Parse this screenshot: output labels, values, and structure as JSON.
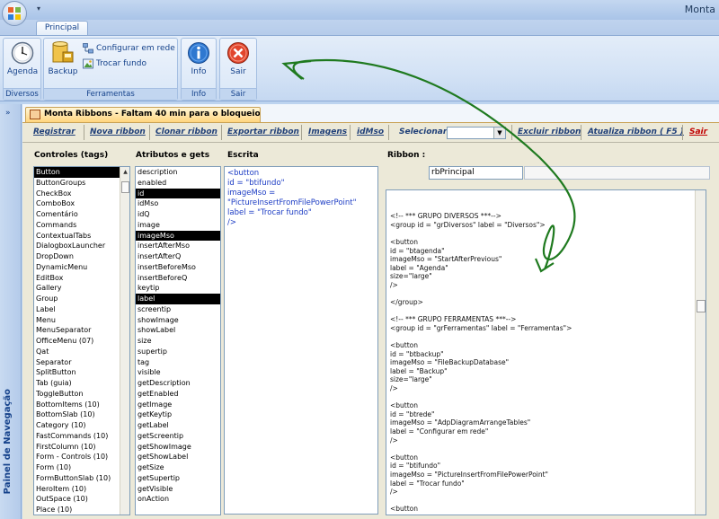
{
  "window": {
    "title": "Monta"
  },
  "tabs": [
    {
      "label": "Principal"
    }
  ],
  "ribbon": {
    "groups": [
      {
        "label": "Diversos",
        "buttons": [
          {
            "label": "Agenda",
            "icon": "clock-icon"
          }
        ]
      },
      {
        "label": "Ferramentas",
        "buttons": [
          {
            "label": "Backup",
            "icon": "database-backup-icon"
          },
          {
            "label": "Configurar em rede",
            "icon": "network-icon"
          },
          {
            "label": "Trocar fundo",
            "icon": "picture-icon"
          }
        ]
      },
      {
        "label": "Info",
        "buttons": [
          {
            "label": "Info",
            "icon": "info-icon"
          }
        ]
      },
      {
        "label": "Sair",
        "buttons": [
          {
            "label": "Sair",
            "icon": "close-icon"
          }
        ]
      }
    ]
  },
  "nav_pane": {
    "label": "Painel de Navegação",
    "toggle": "»"
  },
  "form": {
    "tab_title": "Monta Ribbons - Faltam 40 min para o bloqueio...",
    "toolbar": {
      "registrar": "Registrar",
      "nova_ribbon": "Nova ribbon",
      "clonar_ribbon": "Clonar ribbon",
      "exportar_ribbon": "Exportar ribbon",
      "imagens": "Imagens",
      "idmso": "idMso",
      "selecionar": "Selecionar",
      "selecionar_value": "",
      "excluir_ribbon": "Excluir ribbon",
      "atualiza_ribbon": "Atualiza ribbon ( F5 )",
      "sair": "Sair"
    },
    "labels": {
      "controles": "Controles (tags)",
      "atributos": "Atributos e gets",
      "escrita": "Escrita",
      "ribbon": "Ribbon :"
    },
    "ribbon_name": "rbPrincipal",
    "controles": [
      "Button",
      "ButtonGroups",
      "CheckBox",
      "ComboBox",
      "Comentário",
      "Commands",
      "ContextualTabs",
      "DialogboxLauncher",
      "DropDown",
      "DynamicMenu",
      "EditBox",
      "Gallery",
      "Group",
      "Label",
      "Menu",
      "MenuSeparator",
      "OfficeMenu (07)",
      "Qat",
      "Separator",
      "SplitButton",
      "Tab (guia)",
      "ToggleButton",
      "BottomItems (10)",
      "BottomSlab (10)",
      "Category (10)",
      "FastCommands (10)",
      "FirstColumn (10)",
      "Form - Controls (10)",
      "Form (10)",
      "FormButtonSlab (10)",
      "HeroItem (10)",
      "OutSpace (10)",
      "Place (10)"
    ],
    "controles_selected": 0,
    "atributos": [
      "description",
      "enabled",
      "id",
      "idMso",
      "idQ",
      "image",
      "imageMso",
      "insertAfterMso",
      "insertAfterQ",
      "insertBeforeMso",
      "insertBeforeQ",
      "keytip",
      "label",
      "screentip",
      "showImage",
      "showLabel",
      "size",
      "supertip",
      "tag",
      "visible",
      "getDescription",
      "getEnabled",
      "getImage",
      "getKeytip",
      "getLabel",
      "getScreentip",
      "getShowImage",
      "getShowLabel",
      "getSize",
      "getSupertip",
      "getVisible",
      "onAction"
    ],
    "atributos_selected": [
      2,
      6,
      12
    ],
    "escrita_lines": [
      "<button",
      "id = \"btifundo\"",
      "imageMso =",
      "\"PictureInsertFromFilePowerPoint\"",
      "label = \"Trocar fundo\"",
      "/>"
    ],
    "xml_lines": [
      "",
      "",
      "<!-- *** GRUPO DIVERSOS ***-->",
      "<group id = \"grDiversos\" label = \"Diversos\">",
      "",
      "<button",
      "id = \"btagenda\"",
      "imageMso = \"StartAfterPrevious\"",
      "label = \"Agenda\"",
      "size=\"large\"",
      "/>",
      "",
      "</group>",
      "",
      "<!-- *** GRUPO FERRAMENTAS ***-->",
      "<group id = \"grFerramentas\" label = \"Ferramentas\">",
      "",
      "<button",
      "id = \"btbackup\"",
      "imageMso = \"FileBackupDatabase\"",
      "label = \"Backup\"",
      "size=\"large\"",
      "/>",
      "",
      "<button",
      "id = \"btrede\"",
      "imageMso = \"AdpDiagramArrangeTables\"",
      "label = \"Configurar em rede\"",
      "/>",
      "",
      "<button",
      "id = \"btifundo\"",
      "imageMso = \"PictureInsertFromFilePowerPoint\"",
      "label = \"Trocar fundo\"",
      "/>",
      "",
      "<button"
    ]
  },
  "colors": {
    "ribbon_text": "#15428b",
    "annotation_arrow": "#1f7a1f",
    "form_tab": "#ffd57e",
    "link_text": "#1f3f78",
    "sair_link": "#c00000"
  }
}
